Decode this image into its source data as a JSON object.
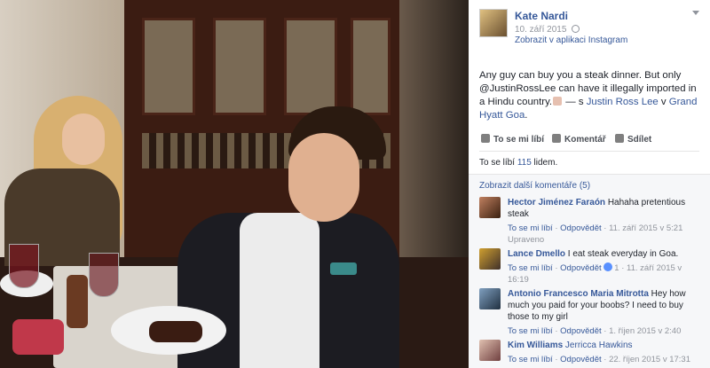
{
  "post": {
    "author": "Kate Nardi",
    "date": "10. září 2015",
    "source": "Zobrazit v aplikaci Instagram",
    "text_before": "Any guy can buy you a steak dinner. But only @JustinRossLee can have it illegally imported in a Hindu country.",
    "text_with": " — s ",
    "tagged_person": "Justin Ross Lee",
    "text_in": " v ",
    "place": "Grand Hyatt Goa",
    "text_end": "."
  },
  "actions": {
    "like": "To se mi líbí",
    "comment": "Komentář",
    "share": "Sdílet"
  },
  "likes": {
    "prefix": "To se líbí ",
    "count": "115",
    "suffix": " lidem."
  },
  "more_comments": "Zobrazit další komentáře (5)",
  "comments": [
    {
      "name": "Hector Jiménez Faraón",
      "text": " Hahaha pretentious steak",
      "like": "To se mi líbí",
      "reply": "Odpovědět",
      "time": "11. září 2015 v 5:21",
      "edited": "Upraveno",
      "reaction_count": ""
    },
    {
      "name": "Lance Dmello",
      "text": " I eat steak everyday in Goa.",
      "like": "To se mi líbí",
      "reply": "Odpovědět",
      "reaction_count": "1",
      "time": "11. září 2015 v 16:19"
    },
    {
      "name": "Antonio Francesco Maria Mitrotta",
      "text": " Hey how much you paid for your boobs? I need to buy those to my girl",
      "like": "To se mi líbí",
      "reply": "Odpovědět",
      "time": "1. říjen 2015 v 2:40"
    },
    {
      "name": "Kim Williams",
      "text": " Jerricca Hawkins",
      "like": "To se mi líbí",
      "reply": "Odpovědět",
      "time": "22. říjen 2015 v 17:31"
    }
  ],
  "icons": {
    "globe": "globe-icon",
    "chevron": "chevron-down-icon",
    "like": "thumbs-up-icon",
    "comment": "comment-icon",
    "share": "share-icon"
  }
}
